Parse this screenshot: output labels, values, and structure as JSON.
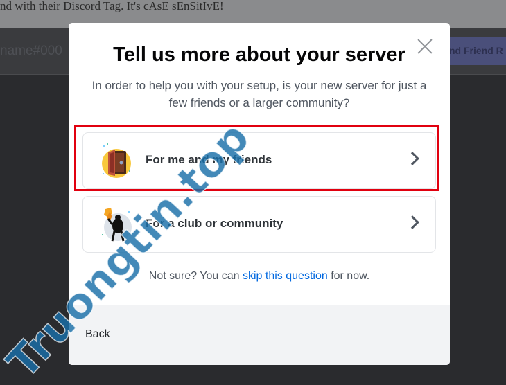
{
  "background": {
    "hint_text": "nd with their Discord Tag. It's cAsE sEnSitIvE!",
    "input_placeholder": "name#000",
    "send_button_label": "nd Friend R"
  },
  "modal": {
    "title": "Tell us more about your server",
    "subtitle": "In order to help you with your setup, is your new server for just a few friends or a larger community?",
    "options": [
      {
        "label": "For me and my friends",
        "icon": "door-friends-icon",
        "highlighted": true
      },
      {
        "label": "For a club or community",
        "icon": "club-community-icon",
        "highlighted": false
      }
    ],
    "not_sure": {
      "prefix": "Not sure? You can",
      "link": "skip this question",
      "suffix": "for now."
    },
    "back_label": "Back",
    "close_icon": "close-icon"
  },
  "watermark": "Truongtin.top",
  "colors": {
    "highlight_box": "#e1000f",
    "link": "#0068e0",
    "watermark": "#1a6fa8"
  }
}
